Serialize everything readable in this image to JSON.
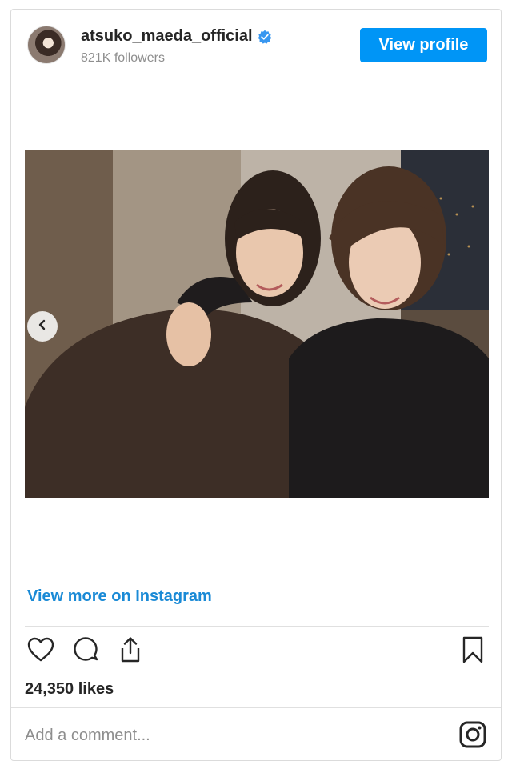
{
  "header": {
    "username": "atsuko_maeda_official",
    "followers": "821K followers",
    "view_profile_label": "View profile",
    "verified_badge": "verified-check-icon"
  },
  "media": {
    "carousel_nav": "chevron-left-icon"
  },
  "footer": {
    "view_more_label": "View more on Instagram",
    "likes": "24,350 likes",
    "comment_placeholder": "Add a comment...",
    "action_icons": [
      "heart-icon",
      "comment-icon",
      "share-icon",
      "bookmark-icon"
    ],
    "brand_icon": "instagram-icon"
  },
  "colors": {
    "accent": "#0095f6",
    "link": "#1a8ad6",
    "border": "#dbdbdb",
    "muted_text": "#8e8e8e",
    "verified": "#3897f0"
  }
}
